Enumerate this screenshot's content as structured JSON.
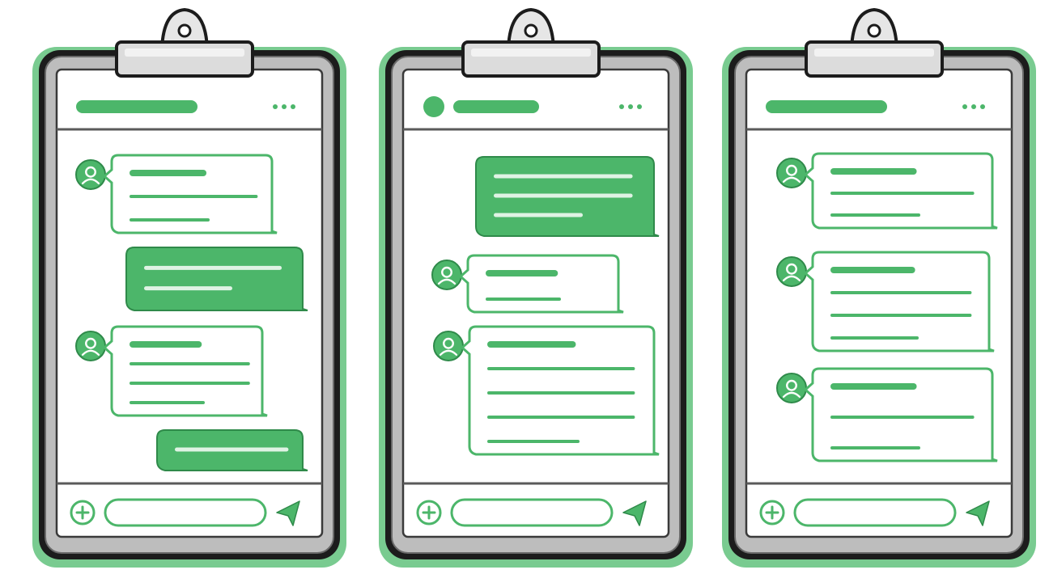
{
  "colors": {
    "accent": "#4cb66a",
    "accent_dark": "#2f8a4a",
    "glow": "#62c27c",
    "frame": "#1c1c1c",
    "metal": "#bdbdbd",
    "paper": "#ffffff"
  },
  "boards": [
    {
      "id": "left",
      "header": {
        "avatar": false,
        "title_line": true,
        "menu": "three-dots"
      },
      "messages": [
        {
          "role": "incoming",
          "avatar": "user-icon",
          "lines": 3
        },
        {
          "role": "outgoing",
          "lines": 2
        },
        {
          "role": "incoming",
          "avatar": "user-icon",
          "lines": 4
        },
        {
          "role": "outgoing",
          "lines": 1
        }
      ],
      "composer": {
        "attach": "plus-icon",
        "send": "send-icon"
      }
    },
    {
      "id": "middle",
      "header": {
        "avatar": true,
        "title_line": true,
        "menu": "three-dots"
      },
      "messages": [
        {
          "role": "outgoing",
          "lines": 3
        },
        {
          "role": "incoming",
          "avatar": "user-icon",
          "lines": 2
        },
        {
          "role": "incoming",
          "avatar": "user-icon",
          "lines": 5
        }
      ],
      "composer": {
        "attach": "plus-icon",
        "send": "send-icon"
      }
    },
    {
      "id": "right",
      "header": {
        "avatar": false,
        "title_line": true,
        "menu": "three-dots"
      },
      "messages": [
        {
          "role": "incoming",
          "avatar": "user-icon",
          "lines": 3
        },
        {
          "role": "incoming",
          "avatar": "user-icon",
          "lines": 4
        },
        {
          "role": "incoming",
          "avatar": "user-icon",
          "lines": 3
        }
      ],
      "composer": {
        "attach": "plus-icon",
        "send": "send-icon"
      }
    }
  ]
}
